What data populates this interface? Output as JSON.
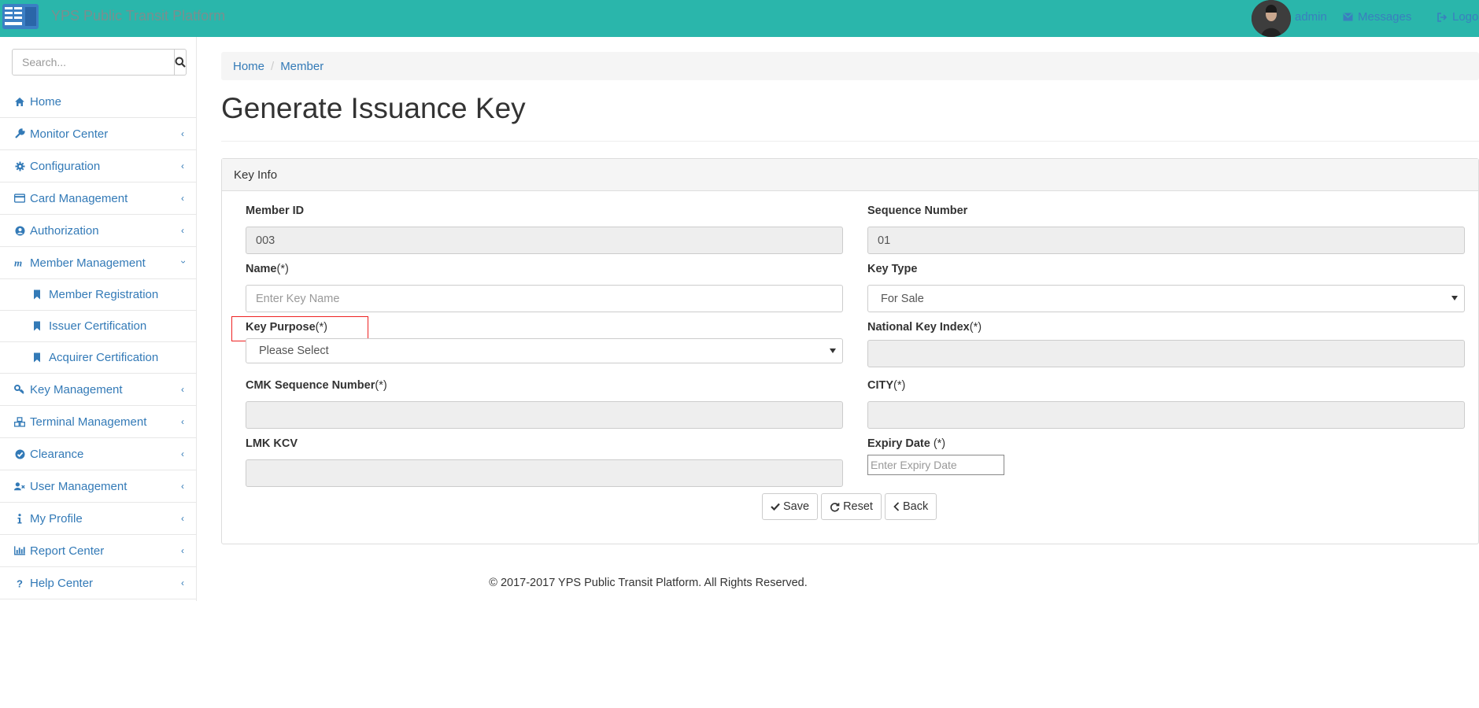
{
  "header": {
    "brand": "YPS Public Transit Platform",
    "user": "admin",
    "messages": "Messages",
    "logout": "Logo",
    "colors": {
      "bar": "#2ab6ab",
      "link": "#3a7fbf"
    }
  },
  "sidebar": {
    "search_placeholder": "Search...",
    "items": [
      {
        "label": "Home",
        "icon": "home-icon"
      },
      {
        "label": "Monitor Center",
        "icon": "wrench-icon"
      },
      {
        "label": "Configuration",
        "icon": "gear-icon"
      },
      {
        "label": "Card Management",
        "icon": "credit-card-icon"
      },
      {
        "label": "Authorization",
        "icon": "user-circle-icon"
      },
      {
        "label": "Member Management",
        "icon": "member-m-icon"
      },
      {
        "label": "Member Registration",
        "icon": "bookmark-icon"
      },
      {
        "label": "Issuer Certification",
        "icon": "bookmark-icon"
      },
      {
        "label": "Acquirer Certification",
        "icon": "bookmark-icon"
      },
      {
        "label": "Key Management",
        "icon": "key-icon"
      },
      {
        "label": "Terminal Management",
        "icon": "cubes-icon"
      },
      {
        "label": "Clearance",
        "icon": "check-circle-icon"
      },
      {
        "label": "User Management",
        "icon": "user-times-icon"
      },
      {
        "label": "My Profile",
        "icon": "info-icon"
      },
      {
        "label": "Report Center",
        "icon": "bar-chart-icon"
      },
      {
        "label": "Help Center",
        "icon": "question-icon"
      }
    ]
  },
  "breadcrumb": {
    "home": "Home",
    "current": "Member"
  },
  "page_title": "Generate Issuance Key",
  "panel": {
    "heading": "Key Info",
    "fields": {
      "member_id": {
        "label": "Member ID",
        "value": "003"
      },
      "sequence_number": {
        "label": "Sequence Number",
        "value": "01"
      },
      "name": {
        "label": "Name",
        "req": "(*)",
        "placeholder": "Enter Key Name"
      },
      "key_type": {
        "label": "Key Type",
        "value": "For Sale"
      },
      "key_purpose": {
        "label": "Key Purpose",
        "req": "(*)",
        "value": "Please Select"
      },
      "national_key_index": {
        "label": "National Key Index",
        "req": "(*)",
        "value": ""
      },
      "cmk_sequence_number": {
        "label": "CMK Sequence Number",
        "req": "(*)",
        "value": ""
      },
      "city": {
        "label": "CITY",
        "req": "(*)",
        "value": ""
      },
      "lmk_kcv": {
        "label": "LMK KCV",
        "value": ""
      },
      "expiry_date": {
        "label": "Expiry Date ",
        "req": "(*)",
        "placeholder": "Enter Expiry Date"
      }
    },
    "buttons": {
      "save": "Save",
      "reset": "Reset",
      "back": "Back"
    }
  },
  "footer": "© 2017-2017 YPS Public Transit Platform. All Rights Reserved."
}
